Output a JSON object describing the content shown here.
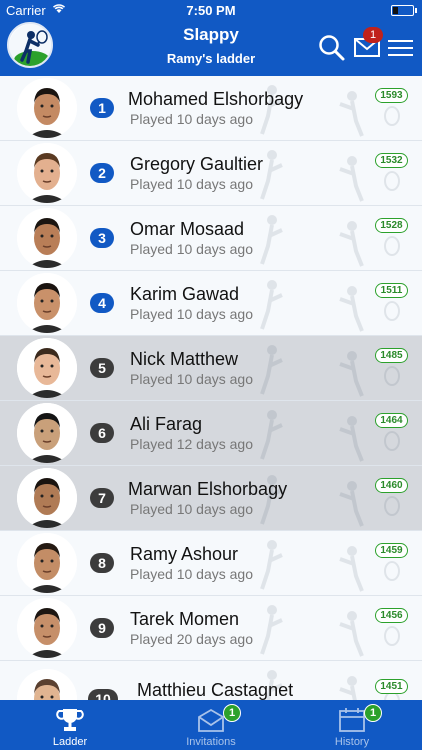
{
  "status_bar": {
    "carrier": "Carrier",
    "time": "7:50 PM"
  },
  "header": {
    "title": "Slappy",
    "subtitle": "Ramy's ladder",
    "mail_badge": "1"
  },
  "players": [
    {
      "rank": "1",
      "name": "Mohamed Elshorbagy",
      "played": "Played 10 days ago",
      "points": "1593"
    },
    {
      "rank": "2",
      "name": "Gregory Gaultier",
      "played": "Played 10 days ago",
      "points": "1532"
    },
    {
      "rank": "3",
      "name": "Omar Mosaad",
      "played": "Played 10 days ago",
      "points": "1528"
    },
    {
      "rank": "4",
      "name": "Karim Gawad",
      "played": "Played 10 days ago",
      "points": "1511"
    },
    {
      "rank": "5",
      "name": "Nick Matthew",
      "played": "Played 10 days ago",
      "points": "1485"
    },
    {
      "rank": "6",
      "name": "Ali Farag",
      "played": "Played 12 days ago",
      "points": "1464"
    },
    {
      "rank": "7",
      "name": "Marwan Elshorbagy",
      "played": "Played 10 days ago",
      "points": "1460"
    },
    {
      "rank": "8",
      "name": "Ramy Ashour",
      "played": "Played 10 days ago",
      "points": "1459"
    },
    {
      "rank": "9",
      "name": "Tarek Momen",
      "played": "Played 20 days ago",
      "points": "1456"
    },
    {
      "rank": "10",
      "name": "Matthieu Castagnet",
      "played": "",
      "points": "1451"
    }
  ],
  "tabs": [
    {
      "label": "Ladder",
      "icon": "trophy-icon",
      "badge": ""
    },
    {
      "label": "Invitations",
      "icon": "envelope-icon",
      "badge": "1"
    },
    {
      "label": "History",
      "icon": "calendar-icon",
      "badge": "1"
    }
  ],
  "colors": {
    "brand": "#1159c4",
    "badge_red": "#c0221b",
    "points_green": "#2ca12c",
    "rank_blue": "#1159c4",
    "rank_gray": "#3c3c3c"
  }
}
